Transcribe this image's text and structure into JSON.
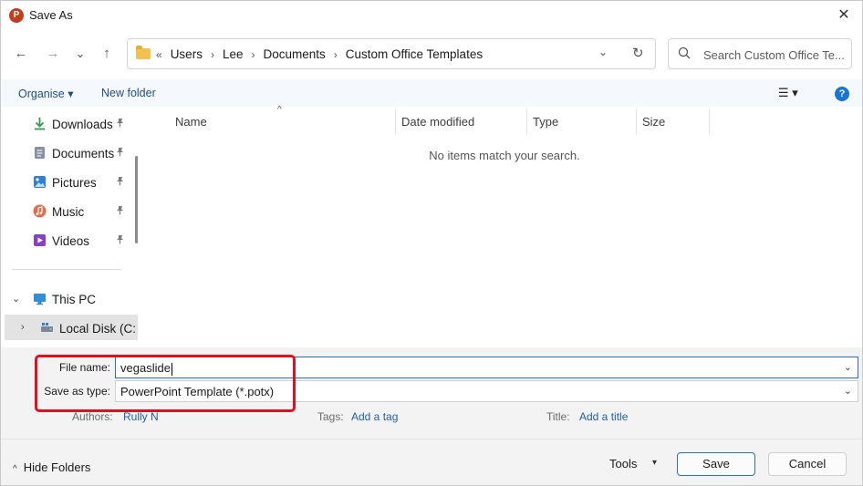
{
  "window": {
    "title": "Save As",
    "app_icon_letter": "P",
    "close_glyph": "✕"
  },
  "nav": {
    "back_glyph": "←",
    "forward_glyph": "→",
    "recent_glyph": "⌄",
    "up_glyph": "↑"
  },
  "address": {
    "overflow": "«",
    "crumbs": [
      "Users",
      "Lee",
      "Documents",
      "Custom Office Templates"
    ],
    "separator": "›",
    "dropdown_glyph": "⌄",
    "refresh_glyph": "↻"
  },
  "search": {
    "placeholder": "Search Custom Office Te..."
  },
  "toolbar": {
    "organise_label": "Organise ▾",
    "new_folder_label": "New folder",
    "view_label": "☰ ▾",
    "help_label": "?"
  },
  "sidebar": {
    "items": [
      {
        "label": "Downloads",
        "icon": "download-icon",
        "color": "#2e9b4f",
        "pinned": true
      },
      {
        "label": "Documents",
        "icon": "document-icon",
        "color": "#6d7b8d",
        "pinned": true
      },
      {
        "label": "Pictures",
        "icon": "picture-icon",
        "color": "#2f7ed8",
        "pinned": true
      },
      {
        "label": "Music",
        "icon": "music-icon",
        "color": "#e26d4c",
        "pinned": true
      },
      {
        "label": "Videos",
        "icon": "video-icon",
        "color": "#8a3fc4",
        "pinned": true
      }
    ],
    "this_pc": "This PC",
    "local_disk": "Local Disk (C:",
    "pin_glyph": "📌",
    "expanded_glyph": "⌄",
    "collapsed_glyph": "›"
  },
  "file_list": {
    "columns": [
      "Name",
      "Date modified",
      "Type",
      "Size"
    ],
    "sort_glyph": "^",
    "empty_message": "No items match your search."
  },
  "form": {
    "file_name_label": "File name:",
    "file_name_value": "vegaslide",
    "save_type_label": "Save as type:",
    "save_type_value": "PowerPoint Template (*.potx)",
    "dropdown_glyph": "⌄",
    "authors_label": "Authors:",
    "authors_value": "Rully N",
    "tags_label": "Tags:",
    "tags_value": "Add a tag",
    "title_label": "Title:",
    "title_value": "Add a title"
  },
  "footer": {
    "hide_folders_label": "Hide Folders",
    "hide_glyph": "^",
    "tools_label": "Tools",
    "tools_dd": "▾",
    "save_label": "Save",
    "cancel_label": "Cancel"
  },
  "colors": {
    "accent": "#2a6fc9",
    "highlight": "#e0101e",
    "link": "#1f5fae"
  }
}
